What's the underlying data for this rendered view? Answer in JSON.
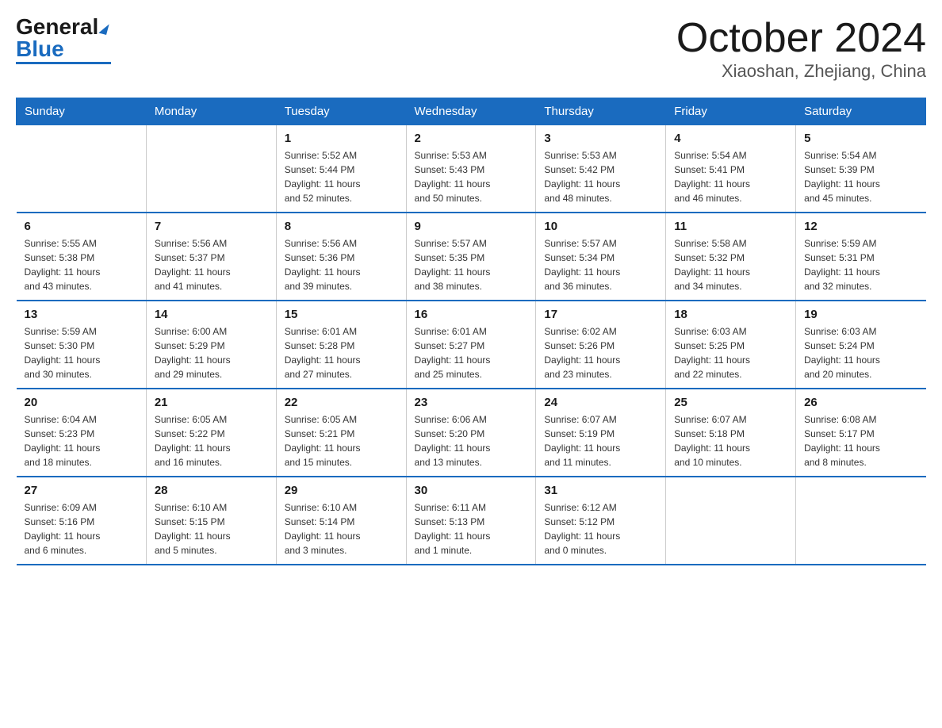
{
  "logo": {
    "general": "General",
    "blue": "Blue"
  },
  "title": "October 2024",
  "location": "Xiaoshan, Zhejiang, China",
  "headers": [
    "Sunday",
    "Monday",
    "Tuesday",
    "Wednesday",
    "Thursday",
    "Friday",
    "Saturday"
  ],
  "weeks": [
    [
      {
        "day": "",
        "info": ""
      },
      {
        "day": "",
        "info": ""
      },
      {
        "day": "1",
        "info": "Sunrise: 5:52 AM\nSunset: 5:44 PM\nDaylight: 11 hours\nand 52 minutes."
      },
      {
        "day": "2",
        "info": "Sunrise: 5:53 AM\nSunset: 5:43 PM\nDaylight: 11 hours\nand 50 minutes."
      },
      {
        "day": "3",
        "info": "Sunrise: 5:53 AM\nSunset: 5:42 PM\nDaylight: 11 hours\nand 48 minutes."
      },
      {
        "day": "4",
        "info": "Sunrise: 5:54 AM\nSunset: 5:41 PM\nDaylight: 11 hours\nand 46 minutes."
      },
      {
        "day": "5",
        "info": "Sunrise: 5:54 AM\nSunset: 5:39 PM\nDaylight: 11 hours\nand 45 minutes."
      }
    ],
    [
      {
        "day": "6",
        "info": "Sunrise: 5:55 AM\nSunset: 5:38 PM\nDaylight: 11 hours\nand 43 minutes."
      },
      {
        "day": "7",
        "info": "Sunrise: 5:56 AM\nSunset: 5:37 PM\nDaylight: 11 hours\nand 41 minutes."
      },
      {
        "day": "8",
        "info": "Sunrise: 5:56 AM\nSunset: 5:36 PM\nDaylight: 11 hours\nand 39 minutes."
      },
      {
        "day": "9",
        "info": "Sunrise: 5:57 AM\nSunset: 5:35 PM\nDaylight: 11 hours\nand 38 minutes."
      },
      {
        "day": "10",
        "info": "Sunrise: 5:57 AM\nSunset: 5:34 PM\nDaylight: 11 hours\nand 36 minutes."
      },
      {
        "day": "11",
        "info": "Sunrise: 5:58 AM\nSunset: 5:32 PM\nDaylight: 11 hours\nand 34 minutes."
      },
      {
        "day": "12",
        "info": "Sunrise: 5:59 AM\nSunset: 5:31 PM\nDaylight: 11 hours\nand 32 minutes."
      }
    ],
    [
      {
        "day": "13",
        "info": "Sunrise: 5:59 AM\nSunset: 5:30 PM\nDaylight: 11 hours\nand 30 minutes."
      },
      {
        "day": "14",
        "info": "Sunrise: 6:00 AM\nSunset: 5:29 PM\nDaylight: 11 hours\nand 29 minutes."
      },
      {
        "day": "15",
        "info": "Sunrise: 6:01 AM\nSunset: 5:28 PM\nDaylight: 11 hours\nand 27 minutes."
      },
      {
        "day": "16",
        "info": "Sunrise: 6:01 AM\nSunset: 5:27 PM\nDaylight: 11 hours\nand 25 minutes."
      },
      {
        "day": "17",
        "info": "Sunrise: 6:02 AM\nSunset: 5:26 PM\nDaylight: 11 hours\nand 23 minutes."
      },
      {
        "day": "18",
        "info": "Sunrise: 6:03 AM\nSunset: 5:25 PM\nDaylight: 11 hours\nand 22 minutes."
      },
      {
        "day": "19",
        "info": "Sunrise: 6:03 AM\nSunset: 5:24 PM\nDaylight: 11 hours\nand 20 minutes."
      }
    ],
    [
      {
        "day": "20",
        "info": "Sunrise: 6:04 AM\nSunset: 5:23 PM\nDaylight: 11 hours\nand 18 minutes."
      },
      {
        "day": "21",
        "info": "Sunrise: 6:05 AM\nSunset: 5:22 PM\nDaylight: 11 hours\nand 16 minutes."
      },
      {
        "day": "22",
        "info": "Sunrise: 6:05 AM\nSunset: 5:21 PM\nDaylight: 11 hours\nand 15 minutes."
      },
      {
        "day": "23",
        "info": "Sunrise: 6:06 AM\nSunset: 5:20 PM\nDaylight: 11 hours\nand 13 minutes."
      },
      {
        "day": "24",
        "info": "Sunrise: 6:07 AM\nSunset: 5:19 PM\nDaylight: 11 hours\nand 11 minutes."
      },
      {
        "day": "25",
        "info": "Sunrise: 6:07 AM\nSunset: 5:18 PM\nDaylight: 11 hours\nand 10 minutes."
      },
      {
        "day": "26",
        "info": "Sunrise: 6:08 AM\nSunset: 5:17 PM\nDaylight: 11 hours\nand 8 minutes."
      }
    ],
    [
      {
        "day": "27",
        "info": "Sunrise: 6:09 AM\nSunset: 5:16 PM\nDaylight: 11 hours\nand 6 minutes."
      },
      {
        "day": "28",
        "info": "Sunrise: 6:10 AM\nSunset: 5:15 PM\nDaylight: 11 hours\nand 5 minutes."
      },
      {
        "day": "29",
        "info": "Sunrise: 6:10 AM\nSunset: 5:14 PM\nDaylight: 11 hours\nand 3 minutes."
      },
      {
        "day": "30",
        "info": "Sunrise: 6:11 AM\nSunset: 5:13 PM\nDaylight: 11 hours\nand 1 minute."
      },
      {
        "day": "31",
        "info": "Sunrise: 6:12 AM\nSunset: 5:12 PM\nDaylight: 11 hours\nand 0 minutes."
      },
      {
        "day": "",
        "info": ""
      },
      {
        "day": "",
        "info": ""
      }
    ]
  ]
}
